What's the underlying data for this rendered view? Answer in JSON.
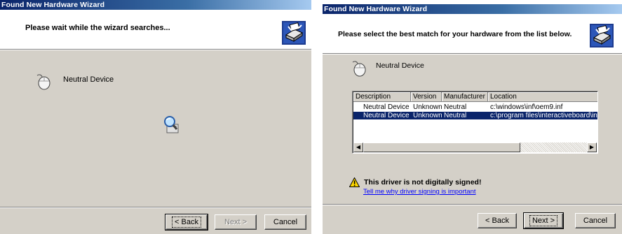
{
  "window1": {
    "title": "Found New Hardware Wizard",
    "header_text": "Please wait while the wizard searches...",
    "device_name": "Neutral Device",
    "buttons": {
      "back": "< Back",
      "next": "Next >",
      "cancel": "Cancel"
    }
  },
  "window2": {
    "title": "Found New Hardware Wizard",
    "header_text": "Please select the best match for your hardware from the list below.",
    "device_name": "Neutral Device",
    "list": {
      "columns": [
        "Description",
        "Version",
        "Manufacturer",
        "Location"
      ],
      "rows": [
        {
          "description": "Neutral Device",
          "version": "Unknown",
          "manufacturer": "Neutral",
          "location": "c:\\windows\\inf\\oem9.inf",
          "selected": false
        },
        {
          "description": "Neutral Device",
          "version": "Unknown",
          "manufacturer": "Neutral",
          "location": "c:\\program files\\interactiveboard\\int",
          "selected": true
        }
      ]
    },
    "warning": {
      "title": "This driver is not digitally signed!",
      "link": "Tell me why driver signing is important"
    },
    "buttons": {
      "back": "< Back",
      "next": "Next >",
      "cancel": "Cancel"
    }
  },
  "colors": {
    "dialog_face": "#d4d0c8",
    "title_start": "#0a246a",
    "title_end": "#a6caf0",
    "selection": "#0a246a",
    "link": "#0000ff",
    "warning_yellow": "#ffd800"
  },
  "icons": [
    "hardware-wizard-icon",
    "mouse-device-icon",
    "magnifier-search-icon",
    "warning-icon",
    "scroll-left-arrow-icon",
    "scroll-right-arrow-icon"
  ]
}
